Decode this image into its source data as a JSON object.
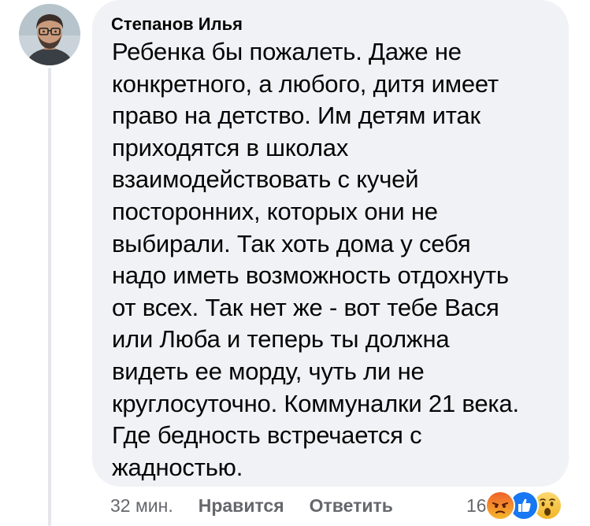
{
  "comment": {
    "author": "Степанов Илья",
    "text_lines": [
      "Ребенка бы пожалеть. Даже не",
      "конкретного, а любого, дитя имеет",
      "право на детство. Им детям итак",
      "приходятся в школах",
      "взаимодействовать с кучей",
      "посторонних, которых они не",
      "выбирали. Так хоть дома у себя",
      "надо иметь возможность отдохнуть",
      "от всех. Так нет же - вот тебе Вася",
      "или Люба и теперь ты должна",
      "видеть ее морду, чуть ли не",
      "круглосуточно. Коммуналки 21 века.",
      "Где бедность встречается с",
      "жадностью."
    ]
  },
  "actions": {
    "time": "32 мин.",
    "like_label": "Нравится",
    "reply_label": "Ответить"
  },
  "reactions": {
    "count": "16",
    "icons": [
      "angry-reaction-icon",
      "like-reaction-icon",
      "wow-reaction-icon"
    ]
  },
  "colors": {
    "bubble": "#f0f2f5",
    "text": "#050505",
    "secondary": "#65676b",
    "like_blue": "#1877f2",
    "angry_orange": "#f0622a",
    "wow_yellow": "#f7c33f"
  }
}
